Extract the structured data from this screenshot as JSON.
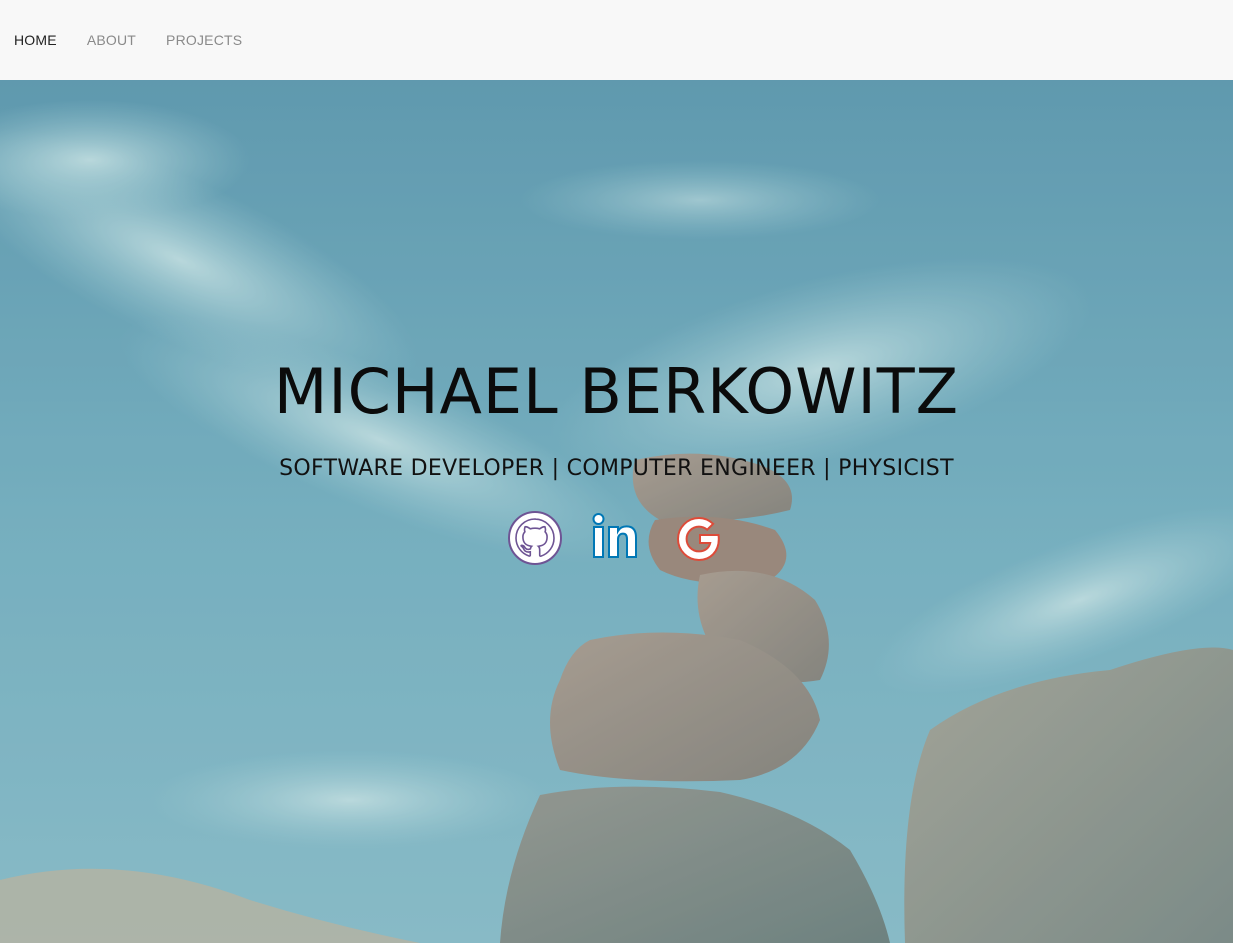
{
  "nav": {
    "items": [
      {
        "label": "HOME",
        "active": true
      },
      {
        "label": "ABOUT",
        "active": false
      },
      {
        "label": "PROJECTS",
        "active": false
      }
    ]
  },
  "hero": {
    "title": "MICHAEL BERKOWITZ",
    "subtitle": "SOFTWARE DEVELOPER | COMPUTER ENGINEER | PHYSICIST",
    "social": [
      {
        "icon": "github-icon",
        "color": "#6e5494"
      },
      {
        "icon": "linkedin-icon",
        "color": "#0077b5"
      },
      {
        "icon": "google-icon",
        "color": "#dd4b39"
      }
    ]
  },
  "colors": {
    "nav_bg": "#f8f8f8",
    "nav_active": "#222222",
    "nav_inactive": "#8a8a8a",
    "sky_overlay": "#6aa6b8"
  }
}
